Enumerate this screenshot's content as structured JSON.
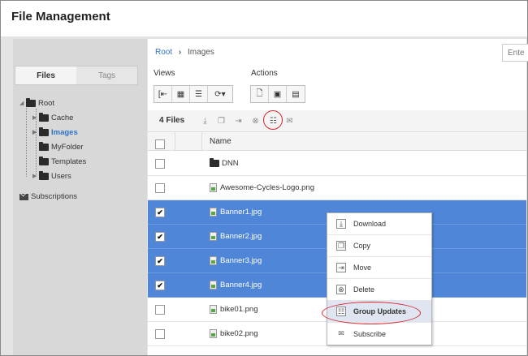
{
  "app": {
    "title": "File Management"
  },
  "sidebar": {
    "tabs": [
      {
        "label": "Files"
      },
      {
        "label": "Tags"
      }
    ],
    "tree": [
      {
        "label": "Root"
      },
      {
        "label": "Cache"
      },
      {
        "label": "Images"
      },
      {
        "label": "MyFolder"
      },
      {
        "label": "Templates"
      },
      {
        "label": "Users"
      }
    ],
    "subscriptions": "Subscriptions"
  },
  "breadcrumb": {
    "root": "Root",
    "separator": "›",
    "current": "Images"
  },
  "search": {
    "value": "Ente"
  },
  "toolbar": {
    "views_label": "Views",
    "actions_label": "Actions"
  },
  "files_toolbar": {
    "count": "4 Files"
  },
  "table": {
    "name_header": "Name",
    "rows": [
      {
        "name": "DNN",
        "type": "folder",
        "checked": false
      },
      {
        "name": "Awesome-Cycles-Logo.png",
        "type": "file",
        "checked": false
      },
      {
        "name": "Banner1.jpg",
        "type": "file",
        "checked": true
      },
      {
        "name": "Banner2.jpg",
        "type": "file",
        "checked": true
      },
      {
        "name": "Banner3.jpg",
        "type": "file",
        "checked": true
      },
      {
        "name": "Banner4.jpg",
        "type": "file",
        "checked": true
      },
      {
        "name": "bike01.png",
        "type": "file",
        "checked": false
      },
      {
        "name": "bike02.png",
        "type": "file",
        "checked": false
      }
    ]
  },
  "context_menu": {
    "items": [
      {
        "label": "Download",
        "icon": "download-icon"
      },
      {
        "label": "Copy",
        "icon": "copy-icon"
      },
      {
        "label": "Move",
        "icon": "move-icon"
      },
      {
        "label": "Delete",
        "icon": "delete-icon"
      },
      {
        "label": "Group Updates",
        "icon": "group-updates-icon"
      },
      {
        "label": "Subscribe",
        "icon": "envelope-icon"
      }
    ]
  },
  "check_glyph": "✔",
  "colors": {
    "selection": "#4f86d8",
    "link": "#2f73c9",
    "highlight_ring": "#d9232e"
  }
}
